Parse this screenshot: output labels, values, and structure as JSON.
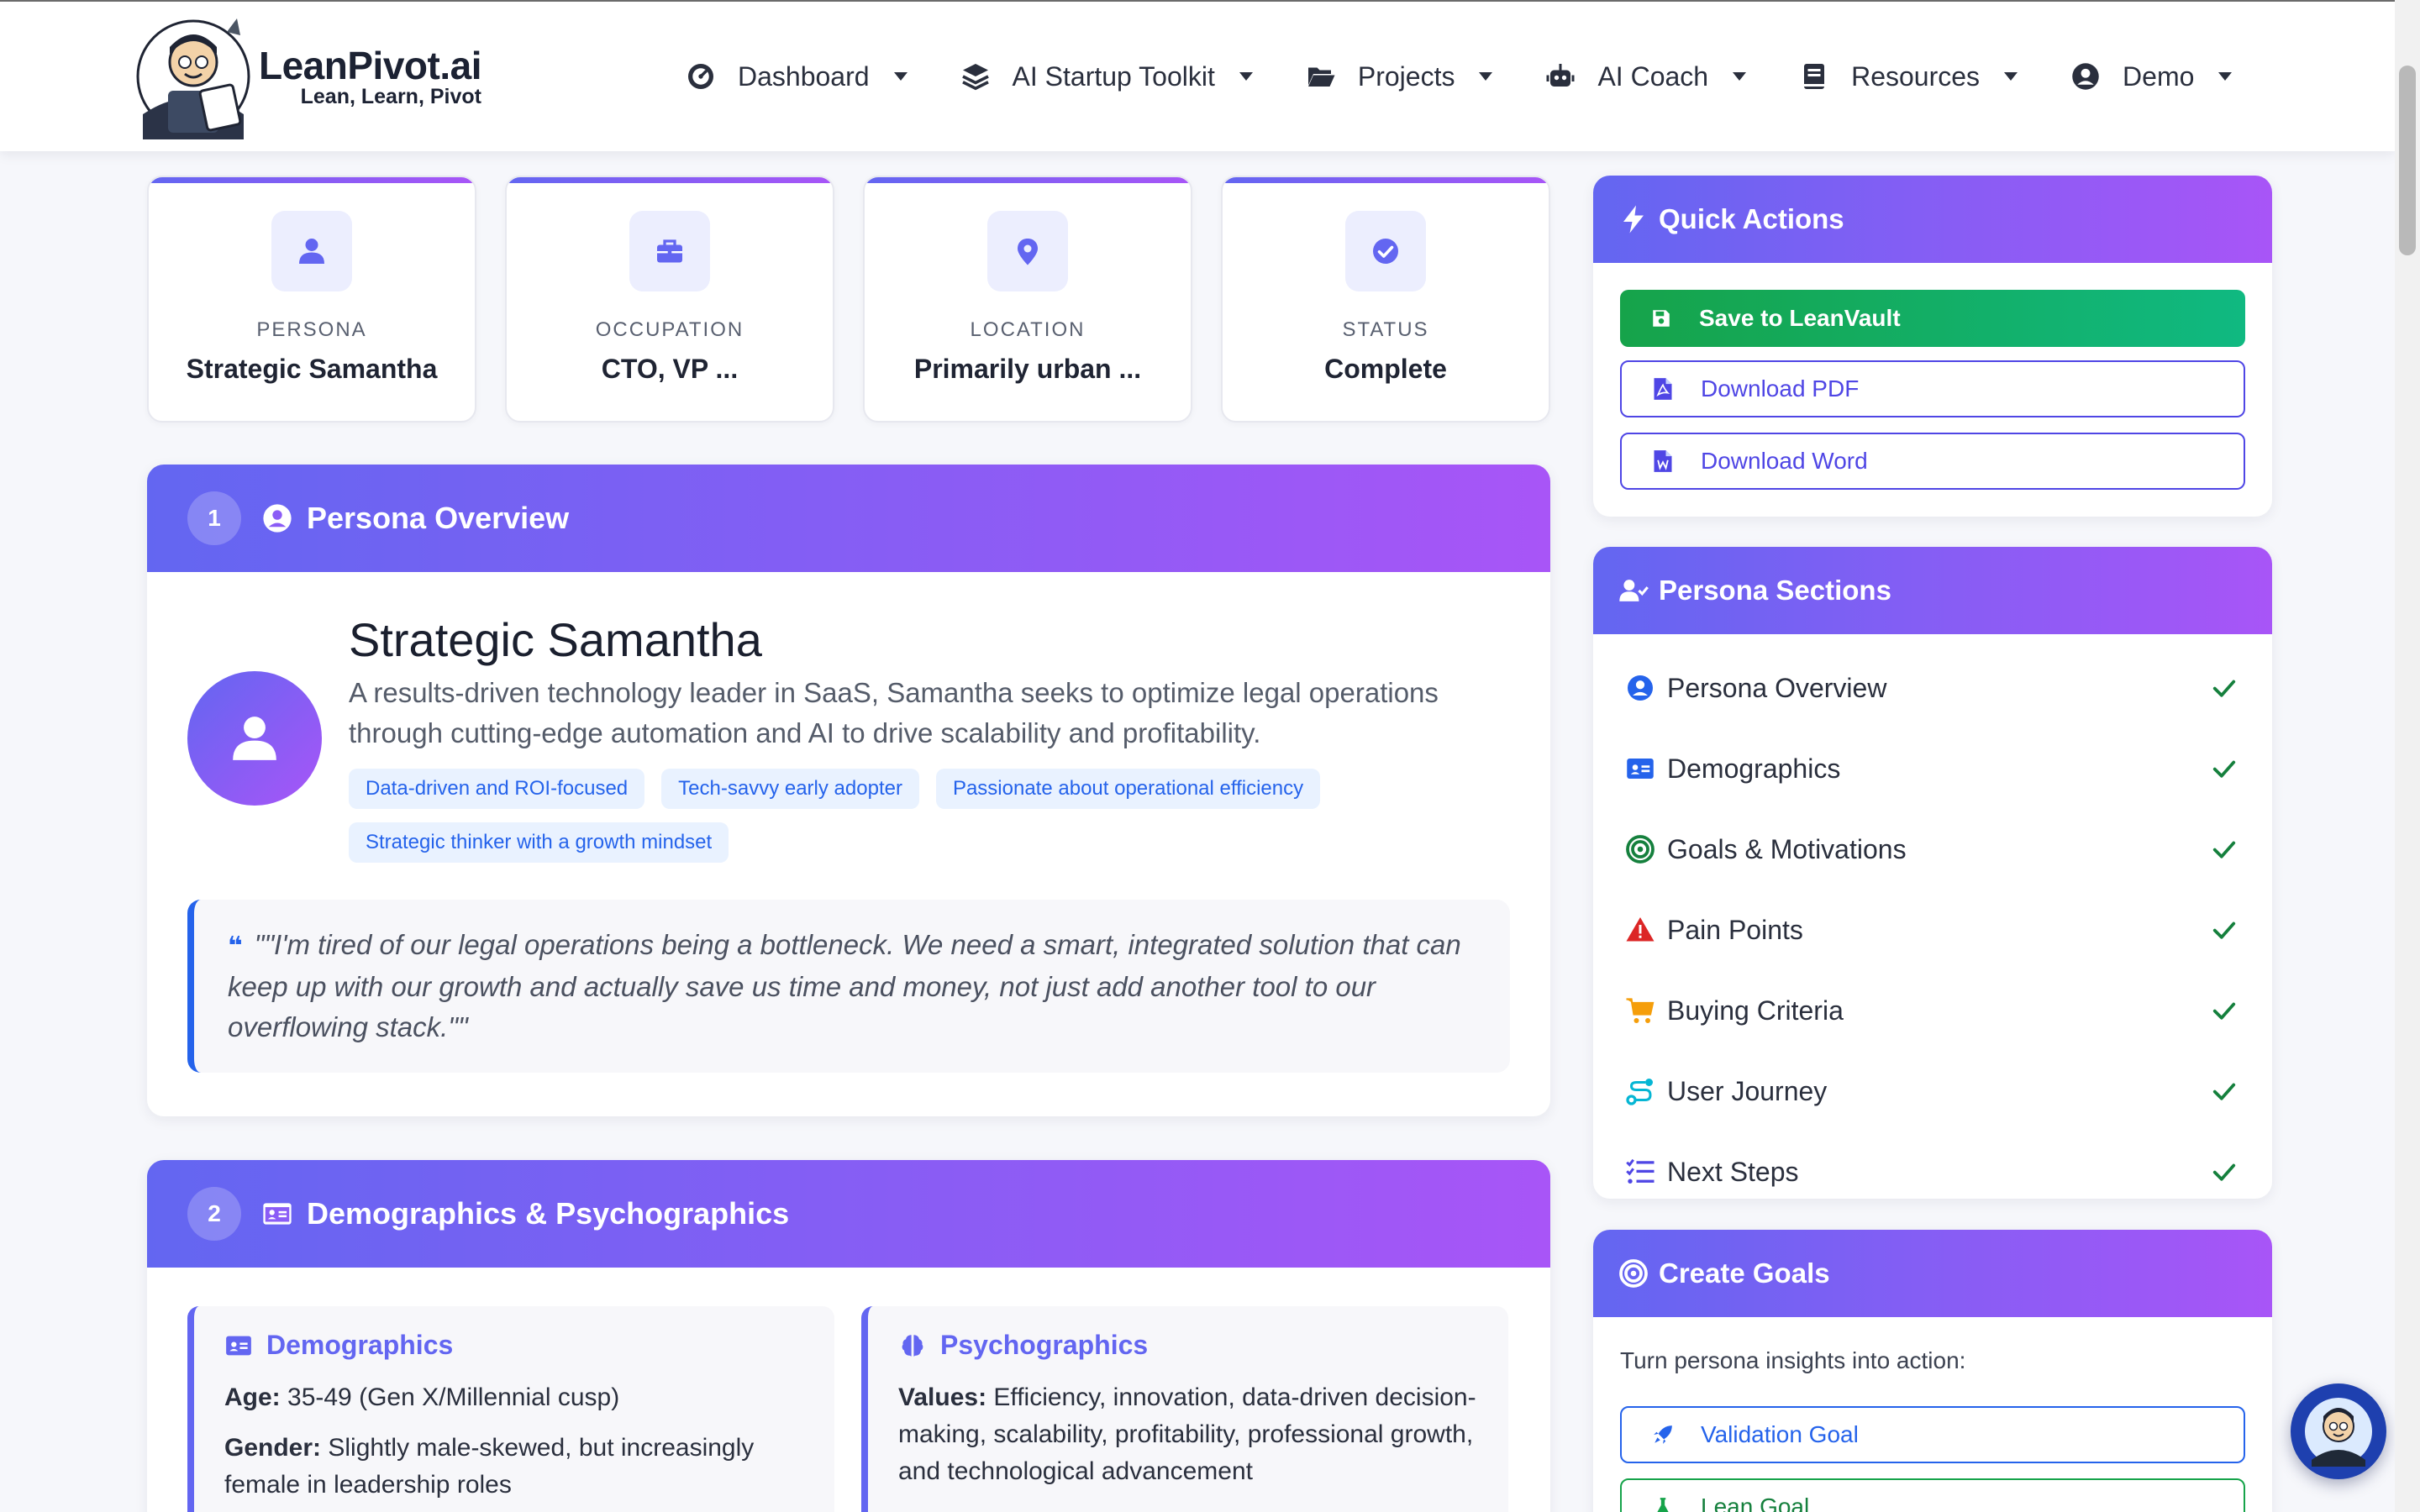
{
  "brand": {
    "name": "LeanPivot.ai",
    "tagline": "Lean, Learn, Pivot"
  },
  "nav": [
    {
      "label": "Dashboard",
      "icon": "gauge-icon"
    },
    {
      "label": "AI Startup Toolkit",
      "icon": "layers-icon"
    },
    {
      "label": "Projects",
      "icon": "folder-open-icon"
    },
    {
      "label": "AI Coach",
      "icon": "robot-icon"
    },
    {
      "label": "Resources",
      "icon": "book-icon"
    },
    {
      "label": "Demo",
      "icon": "user-circle-icon"
    }
  ],
  "stats": [
    {
      "label": "PERSONA",
      "value": "Strategic Samantha",
      "icon": "user-icon"
    },
    {
      "label": "OCCUPATION",
      "value": "CTO, VP ...",
      "icon": "briefcase-icon"
    },
    {
      "label": "LOCATION",
      "value": "Primarily urban ...",
      "icon": "map-pin-icon"
    },
    {
      "label": "STATUS",
      "value": "Complete",
      "icon": "check-circle-icon"
    }
  ],
  "overview": {
    "number": "1",
    "title": "Persona Overview",
    "name": "Strategic Samantha",
    "description": "A results-driven technology leader in SaaS, Samantha seeks to optimize legal operations through cutting-edge automation and AI to drive scalability and profitability.",
    "tags": [
      "Data-driven and ROI-focused",
      "Tech-savvy early adopter",
      "Passionate about operational efficiency",
      "Strategic thinker with a growth mindset"
    ],
    "quote": "\"\"I'm tired of our legal operations being a bottleneck. We need a smart, integrated solution that can keep up with our growth and actually save us time and money, not just add another tool to our overflowing stack.\"\""
  },
  "demographics_section": {
    "number": "2",
    "title": "Demographics & Psychographics",
    "demographics": {
      "title": "Demographics",
      "age_label": "Age:",
      "age_value": "35-49 (Gen X/Millennial cusp)",
      "gender_label": "Gender:",
      "gender_value": "Slightly male-skewed, but increasingly female in leadership roles"
    },
    "psychographics": {
      "title": "Psychographics",
      "values_label": "Values:",
      "values_value": "Efficiency, innovation, data-driven decision-making, scalability, profitability, professional growth, and technological advancement"
    }
  },
  "quick_actions": {
    "title": "Quick Actions",
    "save": "Save to LeanVault",
    "pdf": "Download PDF",
    "word": "Download Word"
  },
  "persona_sections": {
    "title": "Persona Sections",
    "items": [
      {
        "label": "Persona Overview",
        "icon": "user-circle-icon",
        "color": "#2563eb"
      },
      {
        "label": "Demographics",
        "icon": "id-card-icon",
        "color": "#2563eb"
      },
      {
        "label": "Goals & Motivations",
        "icon": "target-icon",
        "color": "#15803d"
      },
      {
        "label": "Pain Points",
        "icon": "warning-icon",
        "color": "#dc2626"
      },
      {
        "label": "Buying Criteria",
        "icon": "cart-icon",
        "color": "#f59e0b"
      },
      {
        "label": "User Journey",
        "icon": "route-icon",
        "color": "#06b6d4"
      },
      {
        "label": "Next Steps",
        "icon": "list-check-icon",
        "color": "#4f46e5"
      }
    ]
  },
  "create_goals": {
    "title": "Create Goals",
    "subtitle": "Turn persona insights into action:",
    "validation": "Validation Goal",
    "lean": "Lean Goal"
  },
  "colors": {
    "accent_start": "#6366f1",
    "accent_end": "#a855f7",
    "green": "#16a34a",
    "blue": "#2563eb"
  }
}
